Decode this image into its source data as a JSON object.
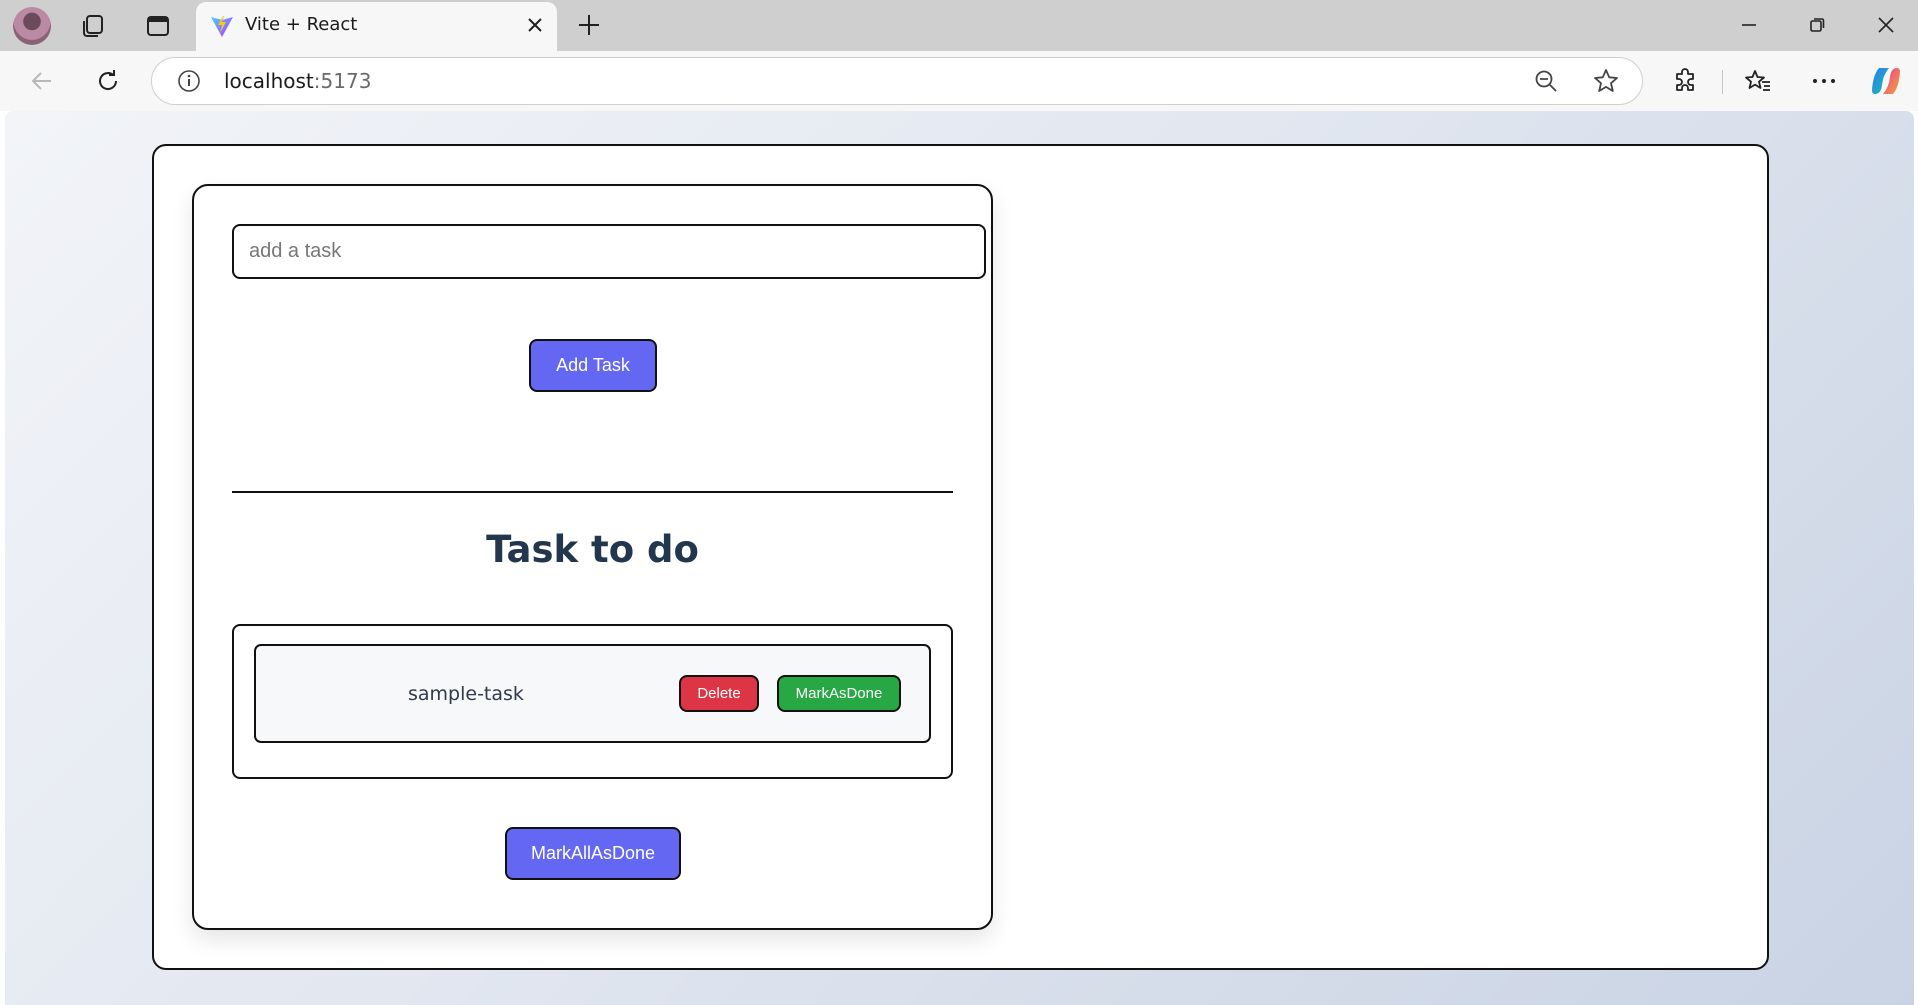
{
  "browser": {
    "tab": {
      "title": "Vite + React"
    },
    "address": {
      "host": "localhost",
      "port": ":5173"
    },
    "icons": {
      "back": "back-arrow-icon",
      "reload": "reload-icon",
      "info": "site-info-icon",
      "zoom": "zoom-out-icon",
      "favorite": "star-icon",
      "extensions": "extensions-icon",
      "favorites": "favorites-icon",
      "more": "more-icon",
      "copilot": "copilot-icon"
    }
  },
  "app": {
    "input": {
      "placeholder": "add a task",
      "value": ""
    },
    "add_button": "Add Task",
    "section_title": "Task to do",
    "tasks": [
      {
        "name": "sample-task",
        "delete_label": "Delete",
        "done_label": "MarkAsDone"
      }
    ],
    "mark_all_button": "MarkAllAsDone",
    "colors": {
      "primary": "#6467f2",
      "danger": "#dc3545",
      "success": "#28a745",
      "heading": "#22364d"
    }
  }
}
